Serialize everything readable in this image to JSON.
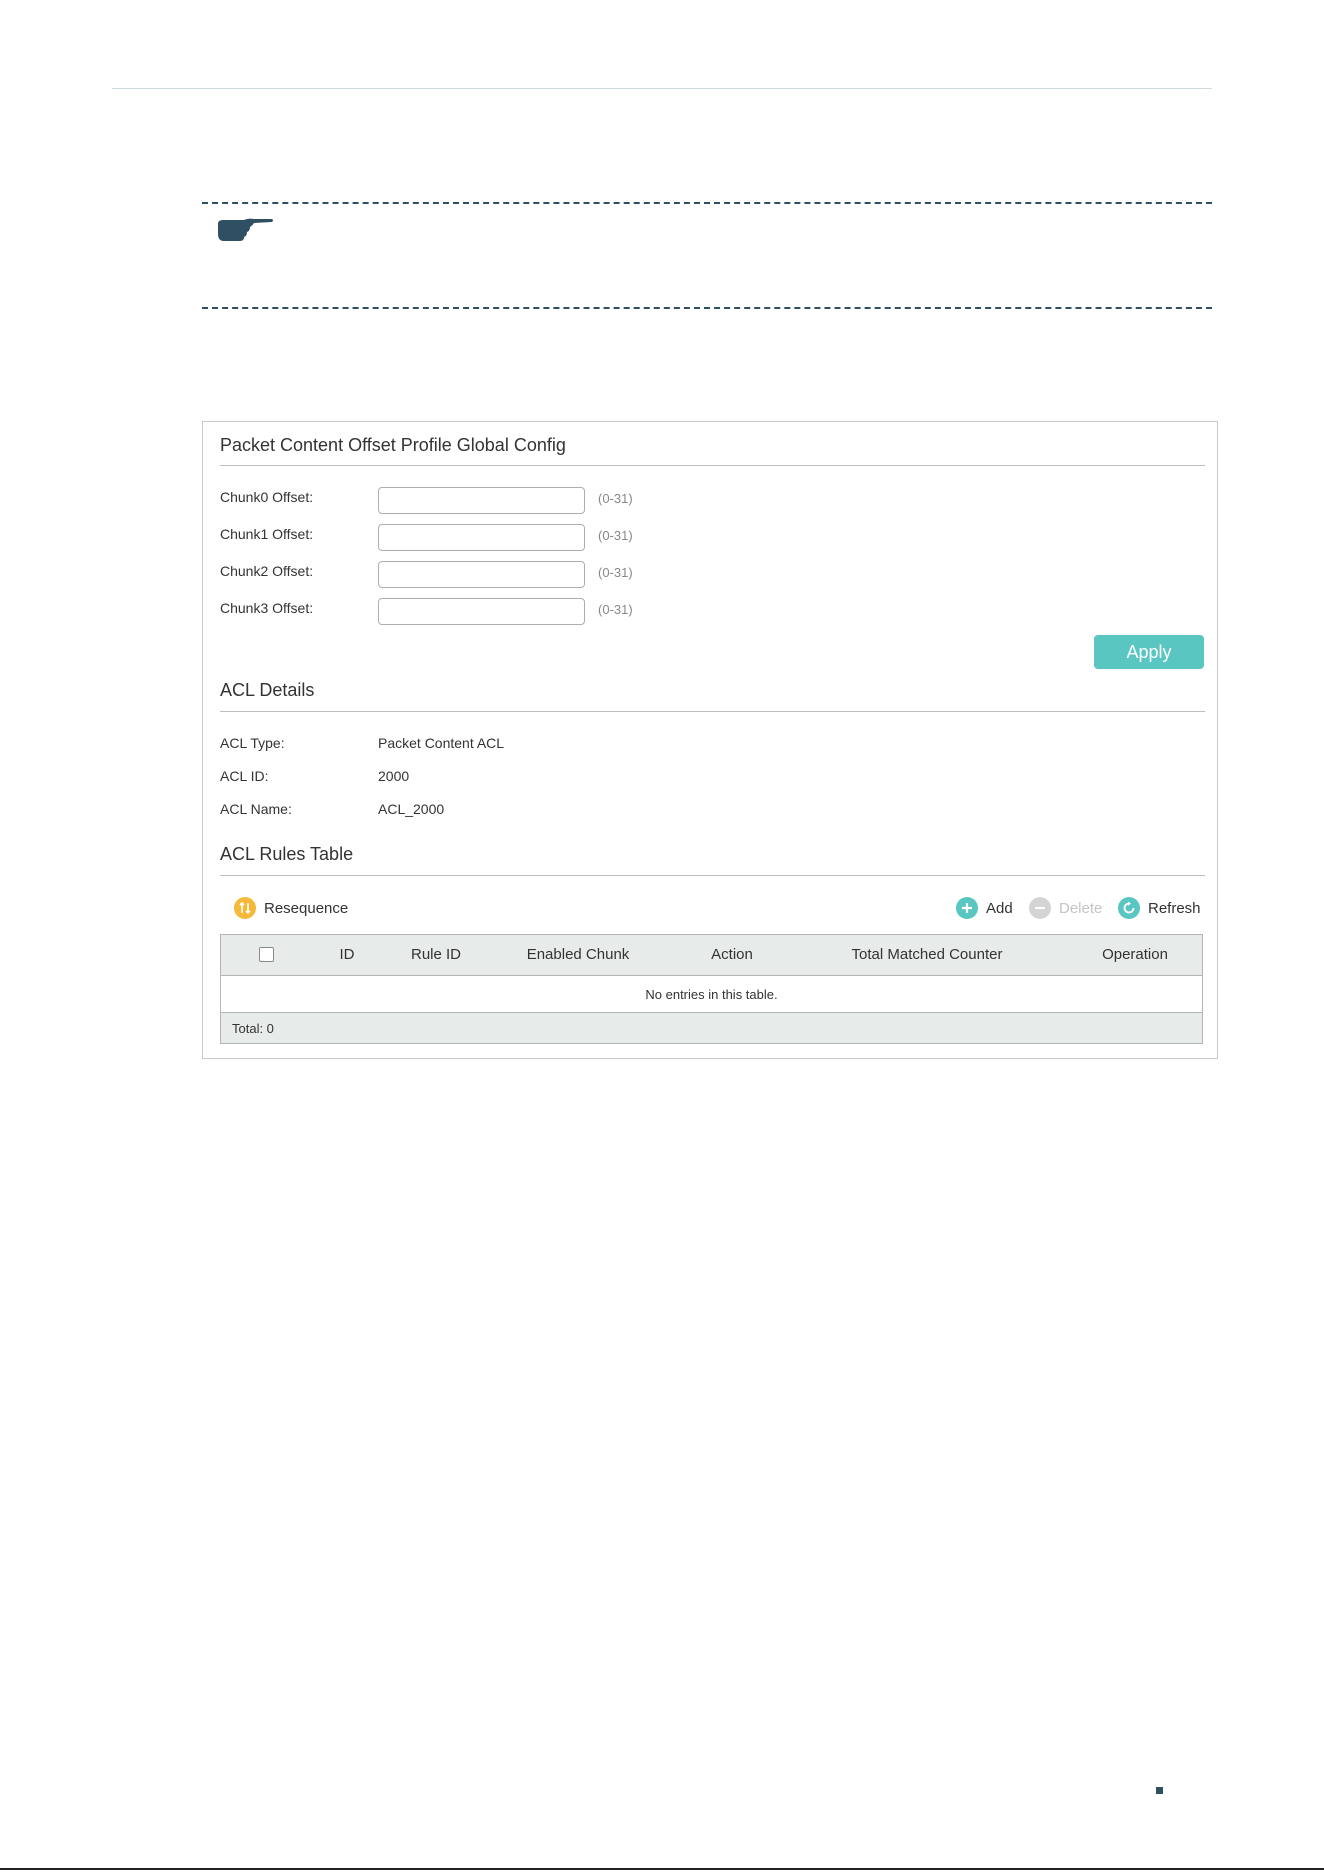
{
  "colors": {
    "accent": "#59c6c2",
    "resequence_icon": "#f5b93a",
    "disabled": "#c5c5c5",
    "note_border": "#2f4f63"
  },
  "note": {
    "icon": "pointing-hand-icon"
  },
  "global_config": {
    "title": "Packet Content Offset Profile Global Config",
    "fields": [
      {
        "label": "Chunk0 Offset:",
        "value": "",
        "hint": "(0-31)"
      },
      {
        "label": "Chunk1 Offset:",
        "value": "",
        "hint": "(0-31)"
      },
      {
        "label": "Chunk2 Offset:",
        "value": "",
        "hint": "(0-31)"
      },
      {
        "label": "Chunk3 Offset:",
        "value": "",
        "hint": "(0-31)"
      }
    ],
    "apply_label": "Apply"
  },
  "acl_details": {
    "title": "ACL Details",
    "rows": [
      {
        "label": "ACL Type:",
        "value": "Packet Content ACL"
      },
      {
        "label": "ACL ID:",
        "value": "2000"
      },
      {
        "label": "ACL Name:",
        "value": "ACL_2000"
      }
    ]
  },
  "rules_table": {
    "title": "ACL Rules Table",
    "toolbar": {
      "resequence": {
        "label": "Resequence",
        "icon": "resequence-icon"
      },
      "add": {
        "label": "Add",
        "icon": "plus-circle-icon"
      },
      "delete": {
        "label": "Delete",
        "icon": "minus-circle-icon",
        "disabled": true
      },
      "refresh": {
        "label": "Refresh",
        "icon": "refresh-icon"
      }
    },
    "columns": [
      "ID",
      "Rule ID",
      "Enabled Chunk",
      "Action",
      "Total Matched Counter",
      "Operation"
    ],
    "rows": [],
    "empty_text": "No entries in this table.",
    "footer": "Total: 0"
  }
}
